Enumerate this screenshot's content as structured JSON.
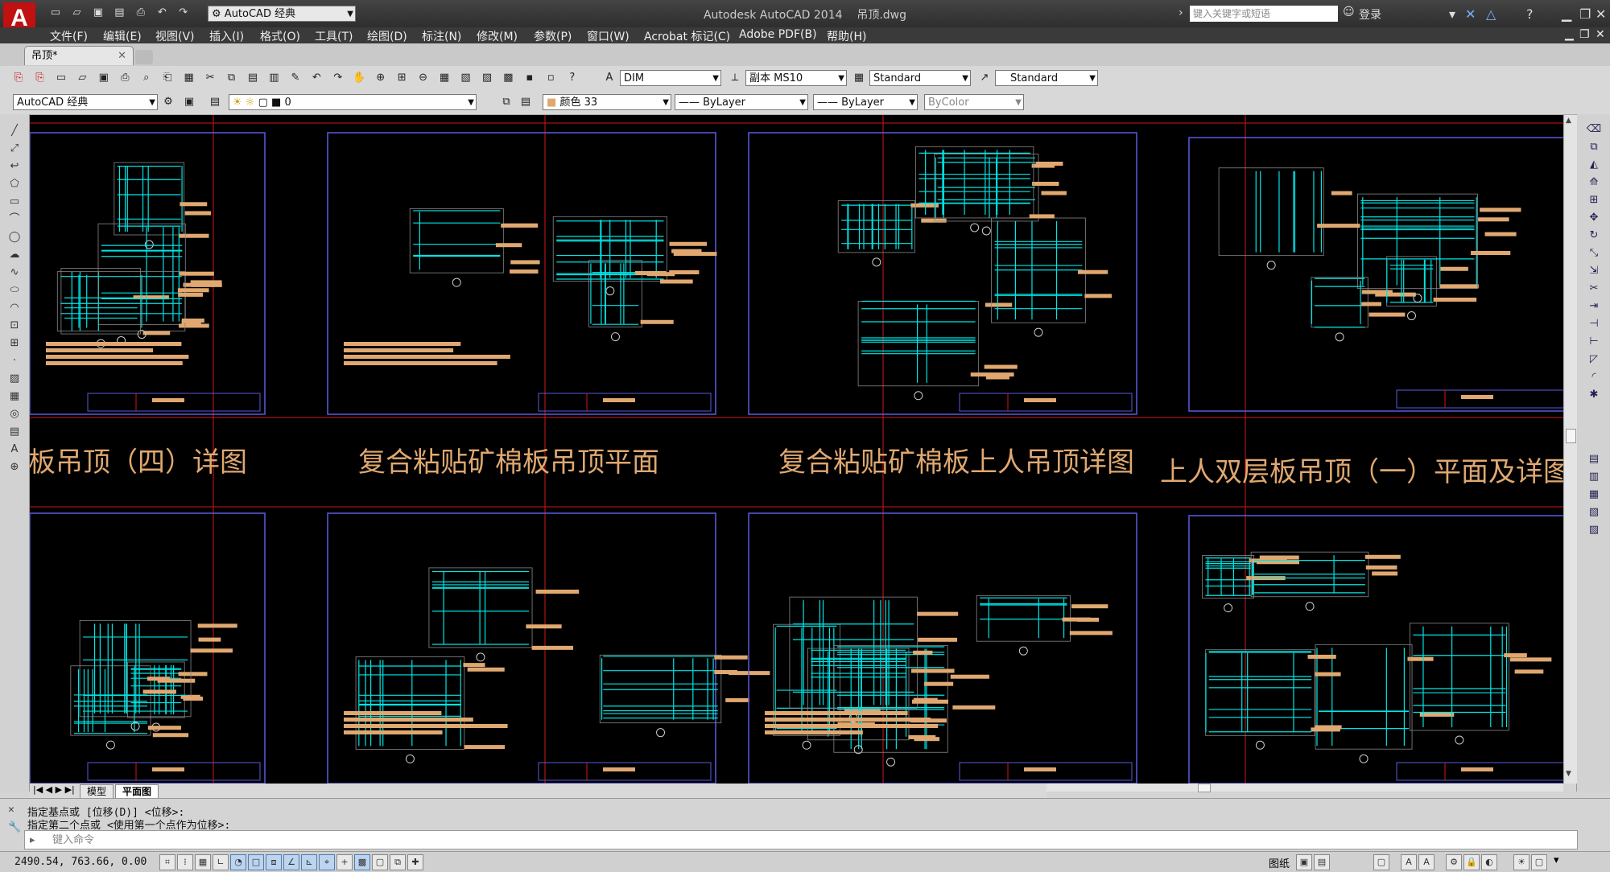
{
  "app": {
    "title": "Autodesk AutoCAD 2014",
    "file_name": "吊顶.dwg",
    "logo_letter": "A",
    "workspace": "AutoCAD 经典",
    "search_placeholder": "键入关键字或短语",
    "login_label": "登录"
  },
  "menu": [
    "文件(F)",
    "编辑(E)",
    "视图(V)",
    "插入(I)",
    "格式(O)",
    "工具(T)",
    "绘图(D)",
    "标注(N)",
    "修改(M)",
    "参数(P)",
    "窗口(W)",
    "Acrobat 标记(C)",
    "Adobe PDF(B)",
    "帮助(H)"
  ],
  "doc_tab": {
    "label": "吊顶*"
  },
  "toolbar1": {
    "dim_style": "DIM",
    "text_style": "副本 MS10",
    "table_style": "Standard",
    "multileader_style": "Standard"
  },
  "toolbar2": {
    "workspace": "AutoCAD 经典",
    "layer": "0",
    "color": "颜色 33",
    "linetype": "ByLayer",
    "lineweight": "ByLayer",
    "plotstyle": "ByColor"
  },
  "drawing": {
    "section_titles": [
      "板吊顶（四）详图",
      "复合粘贴矿棉板吊顶平面",
      "复合粘贴矿棉板上人吊顶详图",
      "上人双层板吊顶（一）平面及详图"
    ]
  },
  "layout_tabs": [
    "模型",
    "平面图"
  ],
  "command_history": [
    "指定基点或 [位移(D)] <位移>:",
    "指定第二个点或 <使用第一个点作为位移>:"
  ],
  "command_prompt": "键入命令",
  "status": {
    "coordinates": "2490.54, 763.66, 0.00",
    "paper_label": "图纸"
  },
  "colors": {
    "canvas": "#000000",
    "drawing_cyan": "#00e5e5",
    "drawing_orange": "#e0a870",
    "frame_blue": "#5a5ae0",
    "cut_red": "#d01818"
  }
}
